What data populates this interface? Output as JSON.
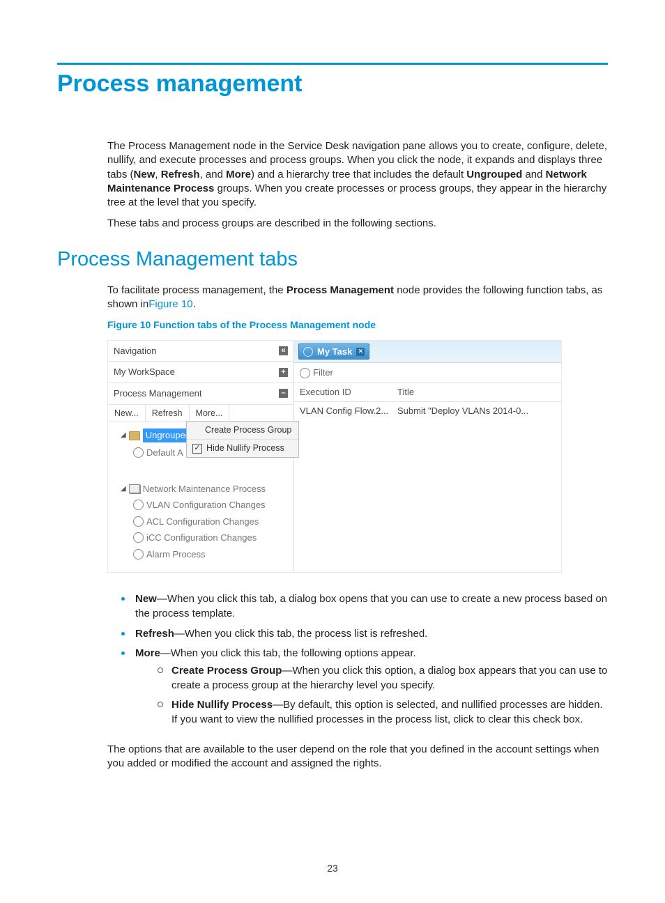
{
  "headings": {
    "h1": "Process management",
    "h2": "Process Management tabs"
  },
  "intro": {
    "p1_pre": "The Process Management node in the Service Desk navigation pane allows you to create, configure, delete, nullify, and execute processes and process groups. When you click the node, it expands and displays three tabs (",
    "b_new": "New",
    "sep1": ", ",
    "b_refresh": "Refresh",
    "sep2": ", and ",
    "b_more": "More",
    "p1_mid": ") and a hierarchy tree that includes the default ",
    "b_ungrouped": "Ungrouped",
    "p1_mid2": " and ",
    "b_nmp": "Network Maintenance Process",
    "p1_post": " groups. When you create processes or process groups, they appear in the hierarchy tree at the level that you specify.",
    "p2": "These tabs and process groups are described in the following sections."
  },
  "tabs_intro": {
    "pre": "To facilitate process management, the ",
    "b_pm": "Process Management",
    "mid": " node provides the following function tabs, as shown in",
    "link": "Figure 10",
    "post": "."
  },
  "figure": {
    "caption": "Figure 10 Function tabs of the Process Management node",
    "nav": {
      "navigation": "Navigation",
      "collapse_glyph": "«",
      "workspace": "My WorkSpace",
      "plus": "+",
      "pm": "Process Management",
      "minus": "–",
      "tabs": {
        "new": "New...",
        "refresh": "Refresh",
        "more": "More..."
      },
      "tree": {
        "ungrouped": "Ungrouped",
        "default_a": "Default A",
        "nmp": "Network Maintenance Process",
        "vlan": "VLAN Configuration Changes",
        "acl": "ACL Configuration Changes",
        "icc": "iCC Configuration Changes",
        "alarm": "Alarm Process"
      },
      "ctx": {
        "create_group": "Create Process Group",
        "hide_nullify": "Hide Nullify Process",
        "check": "✓"
      }
    },
    "content": {
      "tab_label": "My Task",
      "close_glyph": "×",
      "filter": "Filter",
      "col_exec": "Execution ID",
      "col_title": "Title",
      "row_exec": "VLAN Config Flow.2...",
      "row_title": "Submit \"Deploy VLANs 2014-0..."
    }
  },
  "list": {
    "new_b": "New",
    "new_t": "—When you click this tab, a dialog box opens that you can use to create a new process based on the process template.",
    "refresh_b": "Refresh",
    "refresh_t": "—When you click this tab, the process list is refreshed.",
    "more_b": "More",
    "more_t": "—When you click this tab, the following options appear.",
    "cpg_b": "Create Process Group",
    "cpg_t": "—When you click this option, a dialog box appears that you can use to create a process group at the hierarchy level you specify.",
    "hnp_b": "Hide Nullify Process",
    "hnp_t": "—By default, this option is selected, and nullified processes are hidden. If you want to view the nullified processes in the process list, click to clear this check box."
  },
  "closing": "The options that are available to the user depend on the role that you defined in the account settings when you added or modified the account and assigned the rights.",
  "page_number": "23"
}
